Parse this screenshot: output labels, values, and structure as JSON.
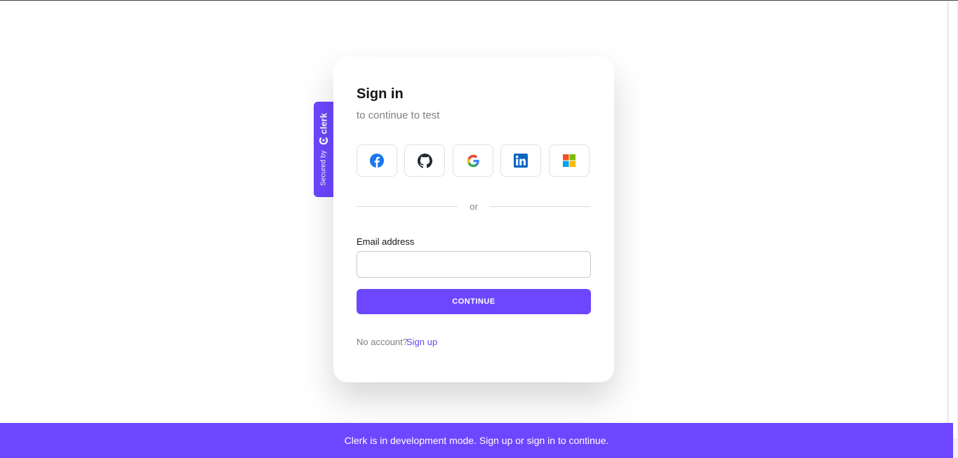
{
  "signin": {
    "title": "Sign in",
    "subtitle": "to continue to test",
    "divider": "or",
    "email_label": "Email address",
    "email_value": "",
    "email_placeholder": "",
    "continue_label": "CONTINUE",
    "no_account": "No account?",
    "signup_link": "Sign up"
  },
  "social_providers": [
    {
      "icon": "facebook-icon",
      "color": "#1877f2"
    },
    {
      "icon": "github-icon",
      "color": "#24292f"
    },
    {
      "icon": "google-icon",
      "color": "#4285f4"
    },
    {
      "icon": "linkedin-icon",
      "color": "#0a66c2"
    },
    {
      "icon": "microsoft-icon",
      "color": "#f25022"
    }
  ],
  "badge": {
    "secured_by": "Secured by",
    "brand": "clerk"
  },
  "banner": {
    "text": "Clerk is in development mode. Sign up or sign in to continue."
  },
  "colors": {
    "accent": "#6c47ff",
    "muted_text": "#808080",
    "border": "#e0e0e0"
  }
}
